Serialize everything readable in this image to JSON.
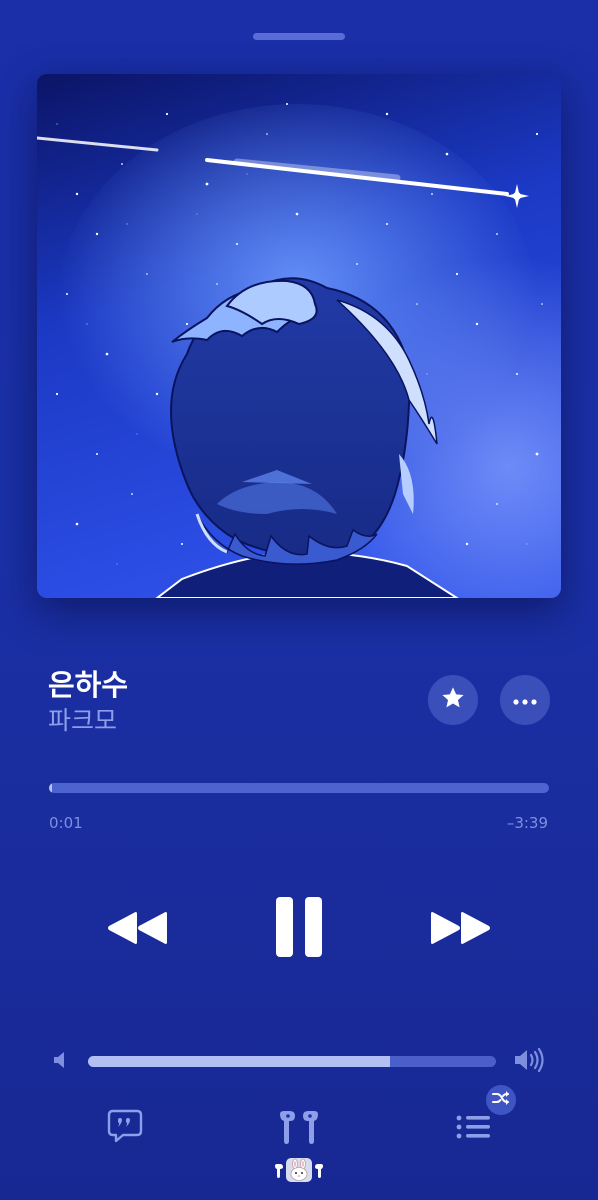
{
  "now_playing": {
    "song_title": "은하수",
    "artist": "파크모",
    "elapsed": "0:01",
    "remaining": "–3:39",
    "progress": 0.005,
    "volume": 0.74
  },
  "icons": {
    "favorite": "star-icon",
    "more": "ellipsis-icon",
    "rewind": "rewind-icon",
    "pause": "pause-icon",
    "forward": "fast-forward-icon",
    "volume_low": "speaker-low-icon",
    "volume_high": "speaker-high-icon",
    "lyrics": "lyrics-quote-icon",
    "airplay": "airpods-icon",
    "queue": "queue-list-icon",
    "shuffle": "shuffle-icon",
    "device_badge": "rabbit-emoji"
  },
  "colors": {
    "background": "#1a2fa8",
    "accent": "#ffffff",
    "secondary_text": "#8e9ee8",
    "track": "#4d63cf"
  }
}
